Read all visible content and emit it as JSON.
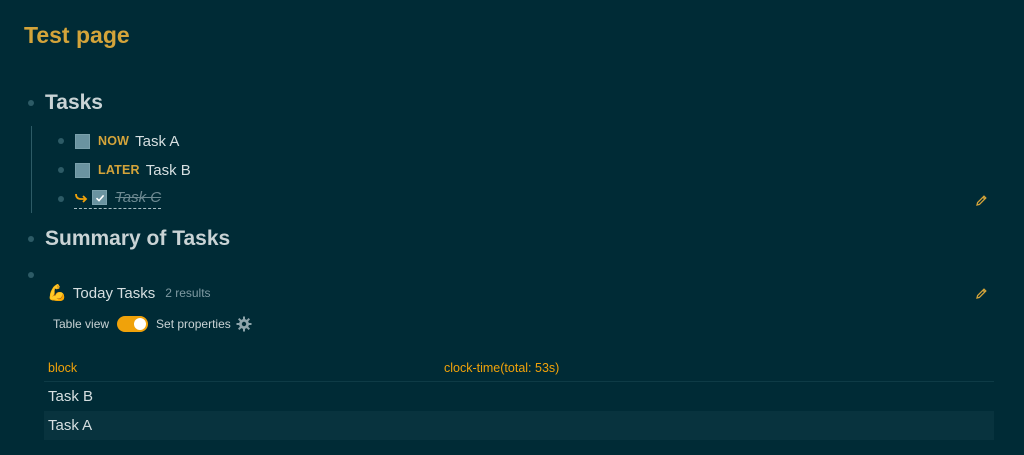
{
  "page": {
    "title": "Test page"
  },
  "sections": {
    "tasks_heading": "Tasks",
    "summary_heading": "Summary of Tasks"
  },
  "tasks": [
    {
      "marker": "NOW",
      "text": "Task A"
    },
    {
      "marker": "LATER",
      "text": "Task B"
    },
    {
      "marker": "",
      "text": "Task C"
    }
  ],
  "query": {
    "emoji": "💪",
    "title": "Today Tasks",
    "count": "2 results",
    "table_view_label": "Table view",
    "set_properties_label": "Set properties"
  },
  "table": {
    "columns": [
      "block",
      "clock-time(total: 53s)"
    ],
    "rows": [
      {
        "block": "Task B"
      },
      {
        "block": "Task A"
      }
    ]
  },
  "colors": {
    "background": "#002b36",
    "accent": "#d4a43a",
    "toggle": "#f0a20a"
  }
}
